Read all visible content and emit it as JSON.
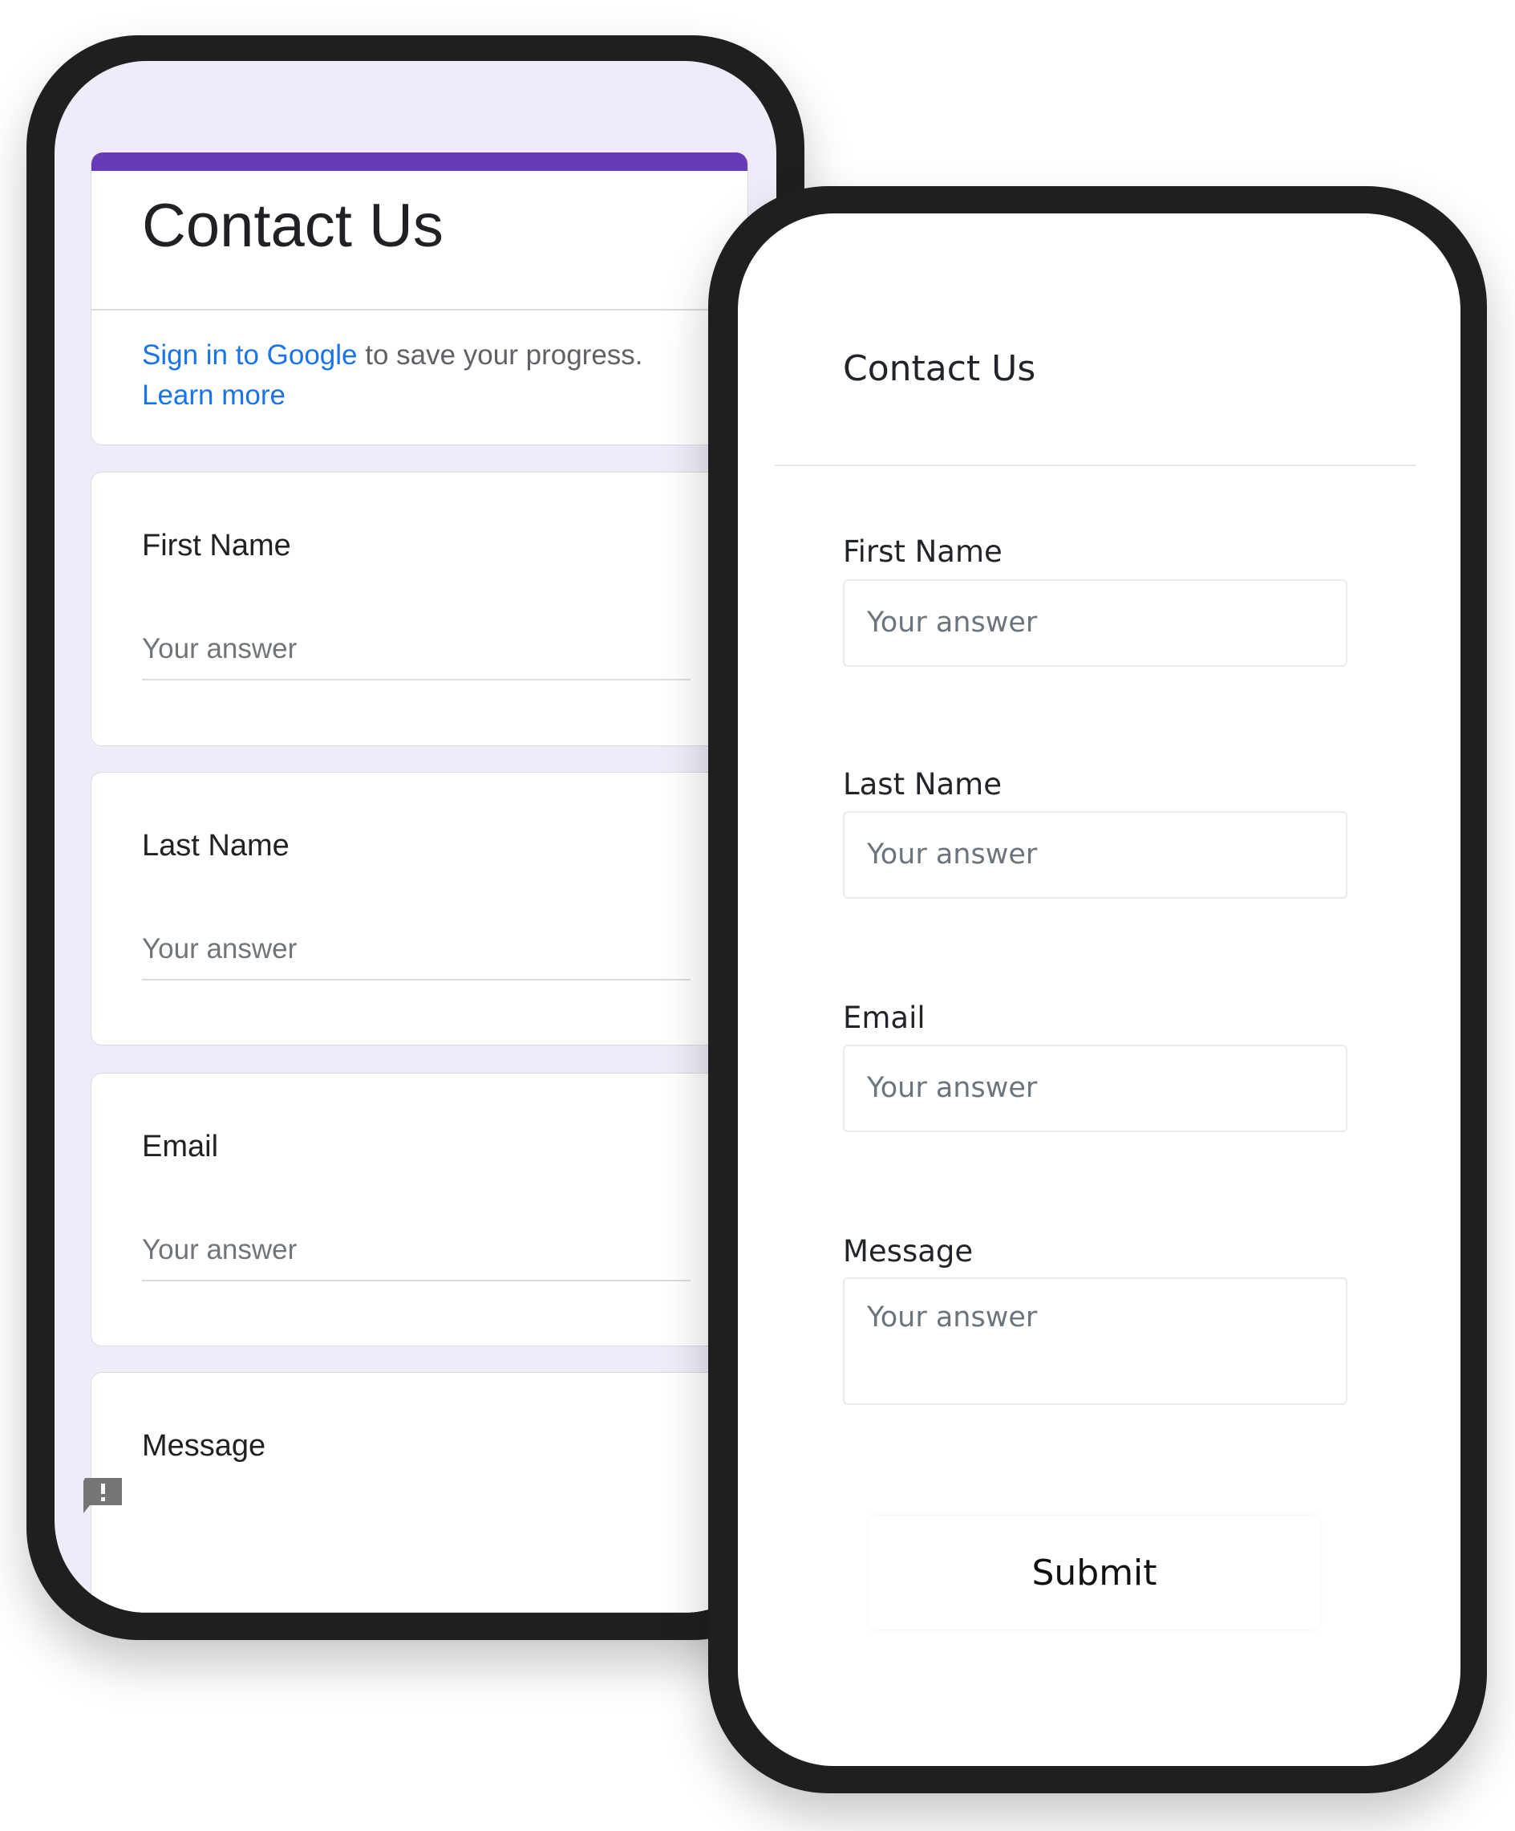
{
  "google_form": {
    "title": "Contact Us",
    "signin_link": "Sign in to Google",
    "signin_text": " to save your progress.",
    "learn_more": "Learn more",
    "questions": [
      {
        "label": "First Name",
        "placeholder": "Your answer"
      },
      {
        "label": "Last Name",
        "placeholder": "Your answer"
      },
      {
        "label": "Email",
        "placeholder": "Your answer"
      },
      {
        "label": "Message"
      }
    ],
    "accent": "#673ab7",
    "feedback_icon": "report-feedback-icon"
  },
  "custom_form": {
    "title": "Contact Us",
    "fields": [
      {
        "label": "First Name",
        "placeholder": "Your answer"
      },
      {
        "label": "Last Name",
        "placeholder": "Your answer"
      },
      {
        "label": "Email",
        "placeholder": "Your answer"
      },
      {
        "label": "Message",
        "placeholder": "Your answer"
      }
    ],
    "submit_label": "Submit"
  }
}
